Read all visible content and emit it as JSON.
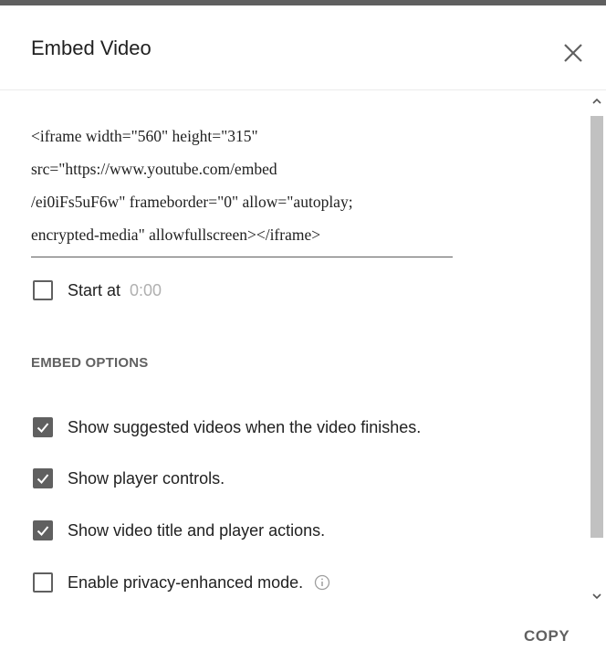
{
  "dialog": {
    "title": "Embed Video",
    "close_icon": "close-icon"
  },
  "embed_code": {
    "lines": [
      "<iframe width=\"560\" height=\"315\"",
      "src=\"https://www.youtube.com/embed",
      "/ei0iFs5uF6w\" frameborder=\"0\" allow=\"autoplay;",
      "encrypted-media\" allowfullscreen></iframe>"
    ]
  },
  "start_at": {
    "label": "Start at",
    "time": "0:00",
    "checked": false
  },
  "embed_options": {
    "heading": "EMBED OPTIONS",
    "items": [
      {
        "label": "Show suggested videos when the video finishes.",
        "checked": true
      },
      {
        "label": "Show player controls.",
        "checked": true
      },
      {
        "label": "Show video title and player actions.",
        "checked": true
      },
      {
        "label": "Enable privacy-enhanced mode.",
        "checked": false,
        "info_icon": "info-icon"
      }
    ]
  },
  "footer": {
    "copy_label": "COPY"
  },
  "colors": {
    "checkbox_fill": "#606060",
    "muted_text": "#616161",
    "placeholder_text": "#b0b0b0",
    "scroll_thumb": "#c1c1c1"
  }
}
